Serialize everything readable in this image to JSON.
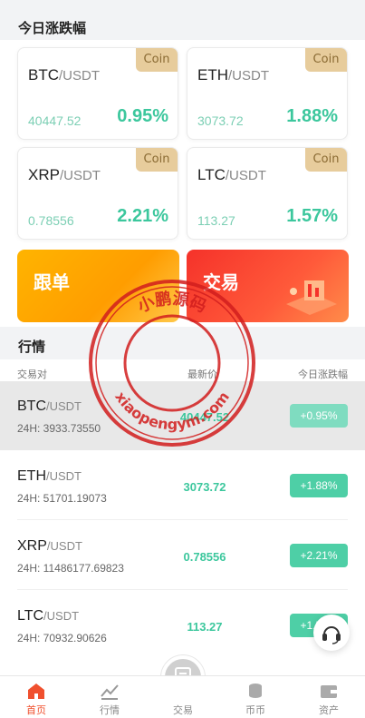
{
  "today_section": {
    "title": "今日涨跌幅"
  },
  "cards": [
    {
      "base": "BTC",
      "quote": "/USDT",
      "badge": "Coin",
      "price": "40447.52",
      "change": "0.95%"
    },
    {
      "base": "ETH",
      "quote": "/USDT",
      "badge": "Coin",
      "price": "3073.72",
      "change": "1.88%"
    },
    {
      "base": "XRP",
      "quote": "/USDT",
      "badge": "Coin",
      "price": "0.78556",
      "change": "2.21%"
    },
    {
      "base": "LTC",
      "quote": "/USDT",
      "badge": "Coin",
      "price": "113.27",
      "change": "1.57%"
    }
  ],
  "banners": {
    "follow": "跟单",
    "trade": "交易"
  },
  "market": {
    "title": "行情",
    "headers": {
      "pair": "交易对",
      "last": "最新价",
      "change": "今日涨跌幅"
    },
    "rows": [
      {
        "base": "BTC",
        "quote": "/USDT",
        "volume": "24H: 3933.73550",
        "last": "40447.52",
        "change": "+0.95%"
      },
      {
        "base": "ETH",
        "quote": "/USDT",
        "volume": "24H: 51701.19073",
        "last": "3073.72",
        "change": "+1.88%"
      },
      {
        "base": "XRP",
        "quote": "/USDT",
        "volume": "24H: 11486177.69823",
        "last": "0.78556",
        "change": "+2.21%"
      },
      {
        "base": "LTC",
        "quote": "/USDT",
        "volume": "24H: 70932.90626",
        "last": "113.27",
        "change": "+1.57%"
      }
    ]
  },
  "watermark": {
    "top_text": "小鹏源码",
    "bottom_text": "xiaopengym.com"
  },
  "tabbar": {
    "items": [
      {
        "label": "首页",
        "icon": "home-icon"
      },
      {
        "label": "行情",
        "icon": "chart-icon"
      },
      {
        "label": "交易",
        "icon": "trade-icon"
      },
      {
        "label": "币币",
        "icon": "coins-icon"
      },
      {
        "label": "资产",
        "icon": "wallet-icon"
      }
    ]
  },
  "colors": {
    "accent": "#f0502e",
    "up": "#3cc79d",
    "badge": "#e7cc9c"
  }
}
